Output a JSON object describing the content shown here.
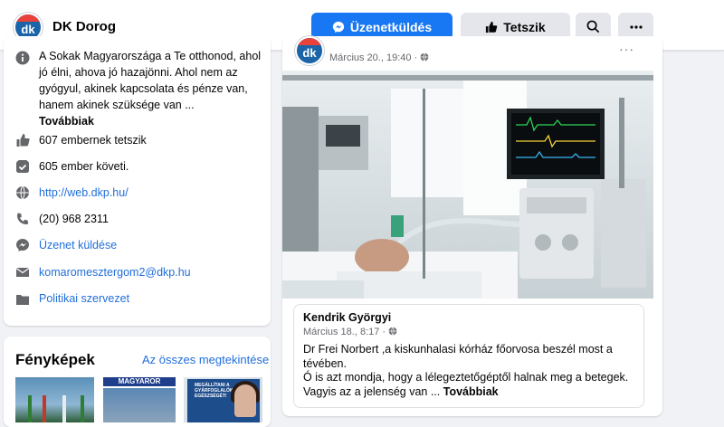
{
  "header": {
    "logo_text": "dk",
    "page_name": "DK Dorog",
    "message_button": "Üzenetküldés",
    "like_button": "Tetszik"
  },
  "colors": {
    "primary": "#1877f2",
    "link": "#216fdb",
    "brand_blue": "#1b64a8",
    "brand_red": "#e8423b"
  },
  "about": {
    "intro_text": "A Sokak Magyarországa a Te otthonod, ahol jó élni, ahova jó hazajönni. Ahol nem az gyógyul, akinek kapcsolata és pénze van, hanem akinek szüksége van ...",
    "see_more": "Továbbiak",
    "likes": "607 embernek tetszik",
    "followers": "605 ember követi.",
    "website": "http://web.dkp.hu/",
    "phone": "(20) 968 2311",
    "message": "Üzenet küldése",
    "email": "komaromesztergom2@dkp.hu",
    "category": "Politikai szervezet"
  },
  "photos": {
    "title": "Fényképek",
    "see_all": "Az összes megtekintése",
    "thumb2_band": "MAGYAROR",
    "thumb3_text": "MEGÁLLÍTANI A GYÁRFOGLALÓKAT EGÉSZSÉGÉT!"
  },
  "post": {
    "date": "Március 20., 19:40 ·",
    "more": "···",
    "shared": {
      "author": "Kendrik Györgyi",
      "date": "Március 18., 8:17 ·",
      "line1": "Dr Frei Norbert ,a kiskunhalasi kórház főorvosa beszél most a tévében.",
      "line2": "Ó is azt mondja, hogy a lélegeztetőgéptől halnak meg a betegek. Vagyis az a jelenség van ...",
      "see_more": "Továbbiak"
    }
  },
  "icons": {
    "info": "info-icon",
    "like": "thumbs-up-icon",
    "follow": "check-box-icon",
    "globe": "globe-icon",
    "phone": "phone-icon",
    "messenger": "messenger-icon",
    "email": "envelope-icon",
    "category": "folder-icon",
    "search": "search-icon",
    "more": "more-dots-icon",
    "globe_privacy": "globe-privacy-icon"
  }
}
